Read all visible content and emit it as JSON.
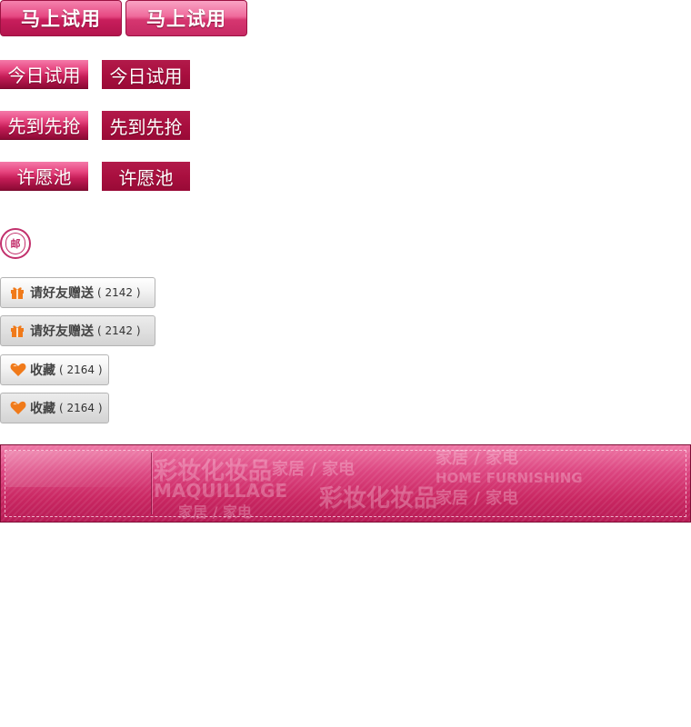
{
  "try_buttons": {
    "label": "马上试用"
  },
  "today_buttons": {
    "label": "今日试用"
  },
  "first_come_buttons": {
    "label": "先到先抢"
  },
  "wish_pool_buttons": {
    "label": "许愿池"
  },
  "postage_badge": {
    "label": "邮"
  },
  "gift_buttons": {
    "label": "请好友赠送",
    "count": "( 2142 )"
  },
  "favorite_buttons": {
    "label": "收藏",
    "count": "( 2164 )"
  },
  "banner": {
    "watermark": {
      "cn_makeup": "彩妆化妆品",
      "home_appliance": "家居 / 家电",
      "en_makeup": "MAQUILLAGE",
      "en_home": "HOME FURNISHING"
    }
  },
  "colors": {
    "brand_pink": "#e64882",
    "brand_dark": "#a90f3f",
    "icon_orange": "#f07a1a"
  }
}
